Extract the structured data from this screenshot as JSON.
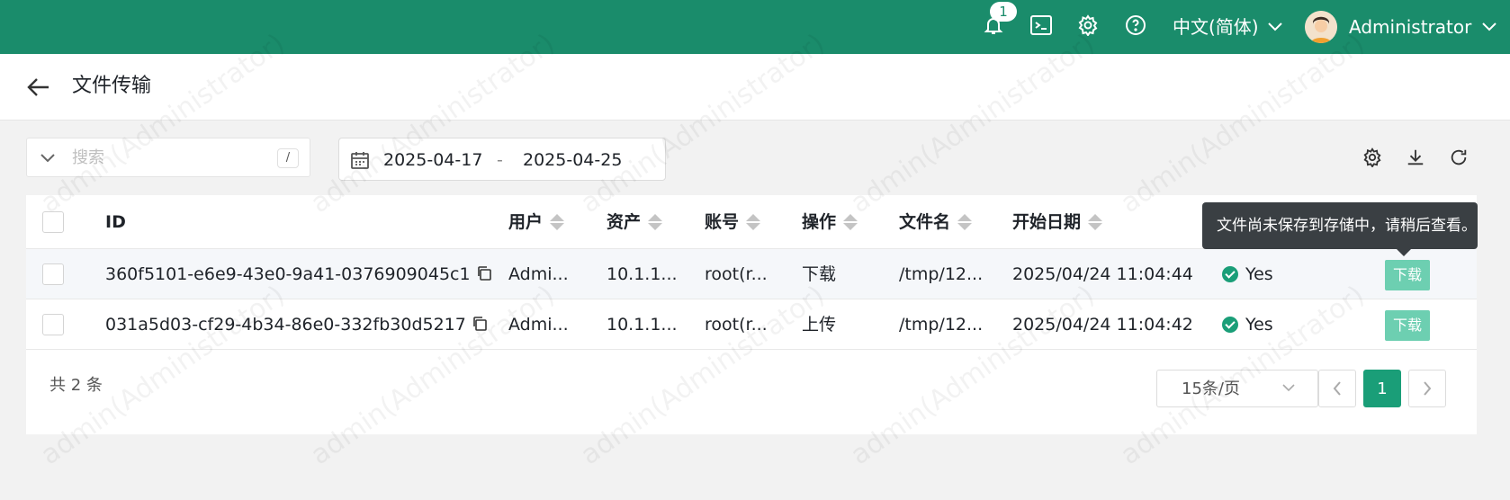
{
  "topbar": {
    "notifications": {
      "icon": "bell-icon",
      "count": "1"
    },
    "terminal_icon": "terminal-icon",
    "settings_icon": "gear-icon",
    "help_icon": "help-circle-icon",
    "language": "中文(简体)",
    "user": "Administrator"
  },
  "header": {
    "title": "文件传输"
  },
  "filters": {
    "search_placeholder": "搜索",
    "shortcut_key": "/",
    "date_start": "2025-04-17",
    "date_separator": "-",
    "date_end": "2025-04-25"
  },
  "table": {
    "columns": [
      "ID",
      "用户",
      "资产",
      "账号",
      "操作",
      "文件名",
      "开始日期"
    ],
    "rows": [
      {
        "id": "360f5101-e6e9-43e0-9a41-0376909045c1",
        "user": "Admi...",
        "asset": "10.1.1...",
        "account": "root(r...",
        "operation": "下载",
        "filename": "/tmp/12...",
        "start_date": "2025/04/24 11:04:44",
        "status": "Yes",
        "action": "下载"
      },
      {
        "id": "031a5d03-cf29-4b34-86e0-332fb30d5217",
        "user": "Admi...",
        "asset": "10.1.1...",
        "account": "root(r...",
        "operation": "上传",
        "filename": "/tmp/12...",
        "start_date": "2025/04/24 11:04:42",
        "status": "Yes",
        "action": "下载"
      }
    ]
  },
  "tooltip": "文件尚未保存到存储中，请稍后查看。",
  "footer": {
    "total": "共 2 条",
    "page_size": "15条/页",
    "current_page": "1"
  },
  "watermark": "admin(Administrator)",
  "colors": {
    "brand": "#1a8c6b",
    "accent": "#1a9e78",
    "button": "#6dcfb1"
  }
}
